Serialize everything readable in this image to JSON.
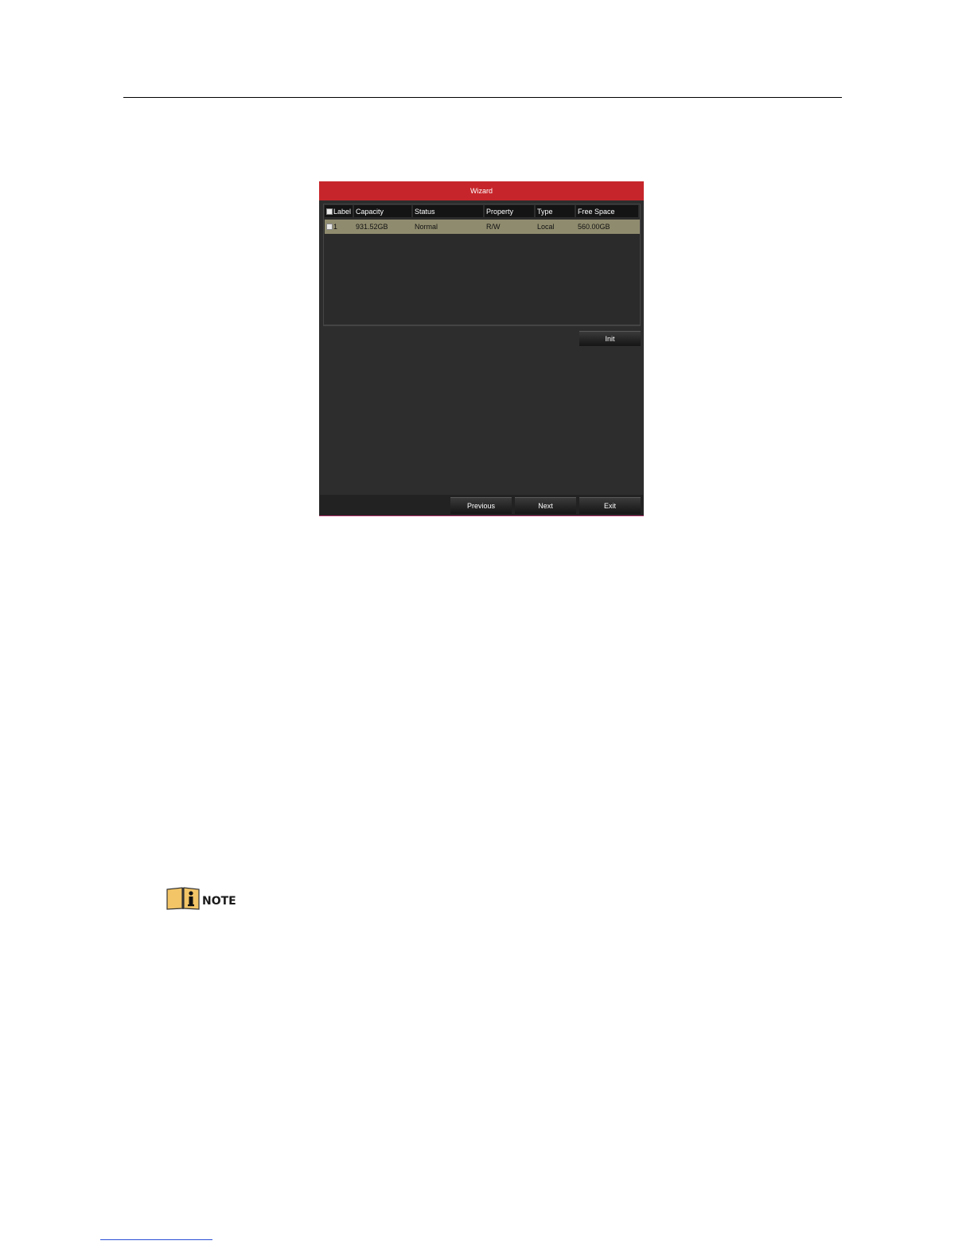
{
  "wizard": {
    "title": "Wizard",
    "columns": [
      "Label",
      "Capacity",
      "Status",
      "Property",
      "Type",
      "Free Space"
    ],
    "rows": [
      {
        "label": "1",
        "capacity": "931.52GB",
        "status": "Normal",
        "property": "R/W",
        "type": "Local",
        "free_space": "560.00GB"
      }
    ],
    "init_label": "Init",
    "previous_label": "Previous",
    "next_label": "Next",
    "exit_label": "Exit"
  },
  "note": {
    "label": "NOTE",
    "icon": "info-book-icon"
  },
  "colors": {
    "title_bar": "#c6262b",
    "panel": "#2d2d2d",
    "selected_row": "#8f8b6e"
  }
}
